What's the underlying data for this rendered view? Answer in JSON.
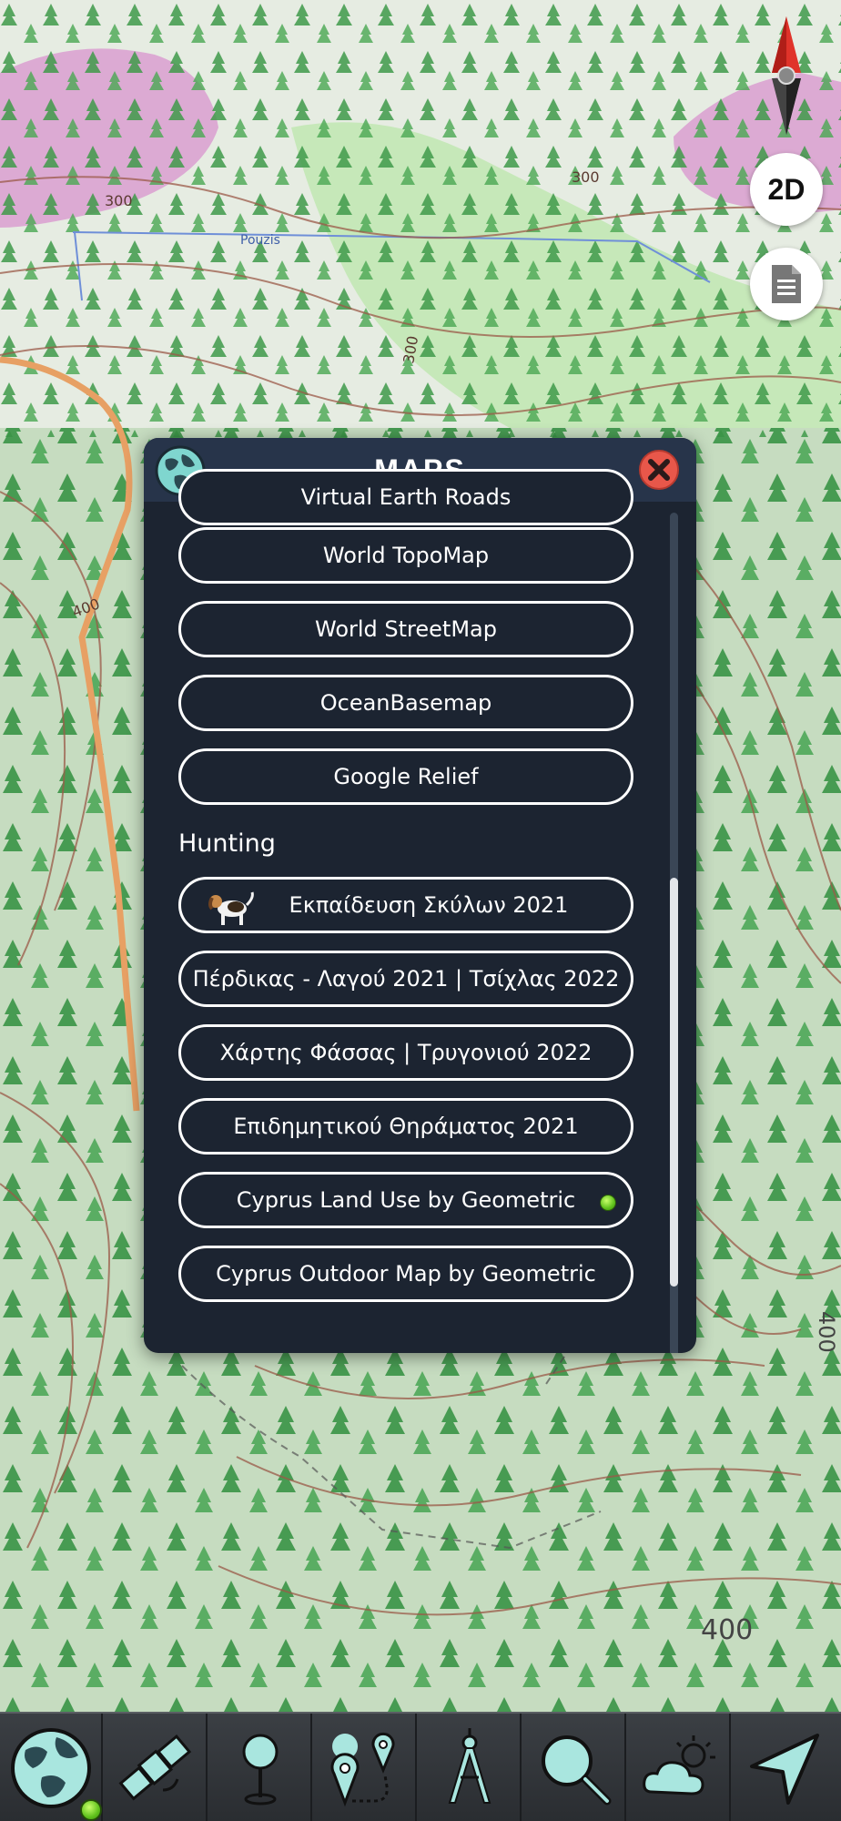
{
  "map": {
    "contour_labels": [
      "300",
      "300",
      "300",
      "400",
      "400",
      "400"
    ],
    "place_label": "Pouzis"
  },
  "controls": {
    "view_mode_label": "2D",
    "compass_icon": "compass-icon",
    "document_icon": "document-icon"
  },
  "panel": {
    "title": "MAPS",
    "globe_icon": "globe-icon",
    "close_icon": "close-icon",
    "items_before": [
      "Virtual Earth Roads",
      "World TopoMap",
      "World StreetMap",
      "OceanBasemap",
      "Google Relief"
    ],
    "section_hunting": "Hunting",
    "hunting_items": [
      "Εκπαίδευση Σκύλων 2021",
      "Πέρδικας - Λαγού 2021 | Τσίχλας 2022",
      "Χάρτης Φάσσας | Τρυγονιού 2022",
      "Επιδημητικού Θηράματος 2021",
      "Cyprus Land Use by Geometric",
      "Cyprus Outdoor Map by Geometric"
    ],
    "active_item": "Cyprus Land Use by Geometric",
    "active_color": "#6fd12a"
  },
  "toolbar": {
    "tools": [
      "globe-maps-icon",
      "satellite-icon",
      "waypoint-pin-icon",
      "route-icon",
      "compass-dividers-icon",
      "search-icon",
      "weather-icon",
      "navigate-arrow-icon"
    ],
    "icon_color": "#a9e6df"
  }
}
